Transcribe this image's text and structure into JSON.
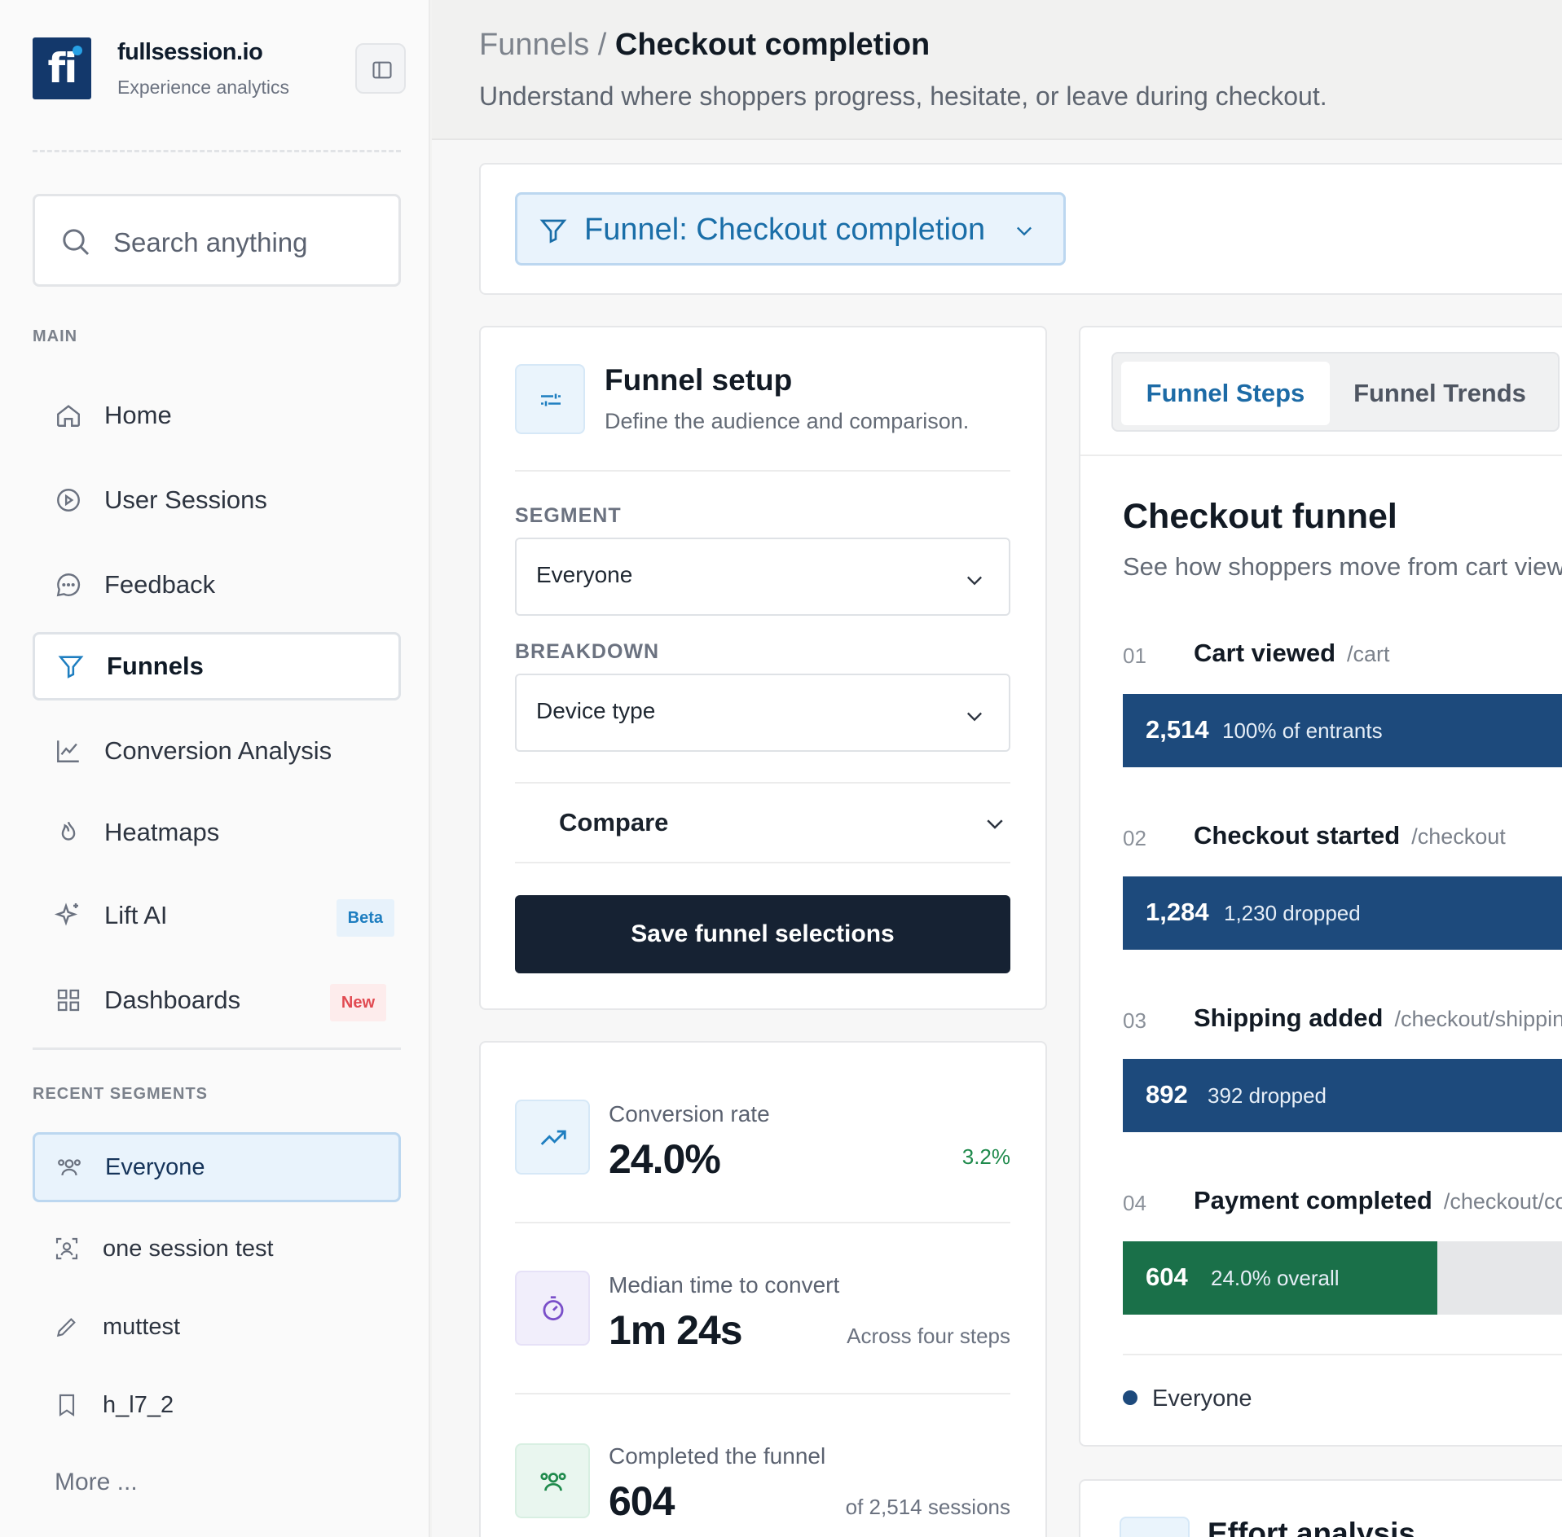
{
  "brand": {
    "logo_text": "fi",
    "name": "fullsession.io",
    "tagline": "Experience analytics"
  },
  "search": {
    "placeholder": "Search anything"
  },
  "sidebar": {
    "main_label": "MAIN",
    "items": [
      {
        "label": "Home",
        "icon": "home-icon"
      },
      {
        "label": "User Sessions",
        "icon": "play-circle-icon"
      },
      {
        "label": "Feedback",
        "icon": "chat-bubble-icon"
      },
      {
        "label": "Funnels",
        "icon": "funnel-icon",
        "active": true
      },
      {
        "label": "Conversion Analysis",
        "icon": "line-chart-icon"
      },
      {
        "label": "Heatmaps",
        "icon": "flame-icon"
      },
      {
        "label": "Lift AI",
        "icon": "sparkle-icon",
        "badge": "Beta"
      },
      {
        "label": "Dashboards",
        "icon": "grid-icon",
        "badge": "New"
      }
    ],
    "recent_label": "RECENT SEGMENTS",
    "segments": [
      {
        "label": "Everyone",
        "icon": "users-icon",
        "active": true
      },
      {
        "label": "one session test",
        "icon": "user-scan-icon"
      },
      {
        "label": "muttest",
        "icon": "pencil-icon"
      },
      {
        "label": "h_l7_2",
        "icon": "bookmark-icon"
      }
    ],
    "more": "More ..."
  },
  "header": {
    "breadcrumb_parent": "Funnels /",
    "breadcrumb_current": "Checkout completion",
    "subtitle": "Understand where shoppers progress, hesitate, or leave during checkout."
  },
  "funnel_selector": {
    "label": "Funnel: Checkout completion"
  },
  "setup": {
    "title": "Funnel setup",
    "subtitle": "Define the audience and comparison.",
    "segment_label": "SEGMENT",
    "segment_value": "Everyone",
    "breakdown_label": "BREAKDOWN",
    "breakdown_value": "Device type",
    "compare_label": "Compare",
    "save_label": "Save funnel selections"
  },
  "stats": [
    {
      "label": "Conversion rate",
      "value": "24.0%",
      "aside": "3.2%",
      "aside_color": "#1f8a4c",
      "icon": "trend-up-icon"
    },
    {
      "label": "Median time to convert",
      "value": "1m 24s",
      "aside": "Across four steps",
      "icon": "stopwatch-icon"
    },
    {
      "label": "Completed the funnel",
      "value": "604",
      "aside": "of 2,514 sessions",
      "icon": "users-icon"
    }
  ],
  "tabs": {
    "active": "Funnel Steps",
    "inactive": "Funnel Trends"
  },
  "checkout": {
    "title": "Checkout funnel",
    "subtitle": "See how shoppers move from cart view",
    "steps": [
      {
        "no": "01",
        "name": "Cart viewed",
        "path": "/cart",
        "count": "2,514",
        "note": "100% of entrants",
        "fraction": 1.0,
        "color": "#1d4a7c"
      },
      {
        "no": "02",
        "name": "Checkout started",
        "path": "/checkout",
        "count": "1,284",
        "note": "1,230 dropped",
        "fraction": 1.0,
        "color": "#1d4a7c"
      },
      {
        "no": "03",
        "name": "Shipping added",
        "path": "/checkout/shippin",
        "count": "892",
        "note": "392 dropped",
        "fraction": 1.0,
        "color": "#1d4a7c"
      },
      {
        "no": "04",
        "name": "Payment completed",
        "path": "/checkout/co",
        "count": "604",
        "note": "24.0% overall",
        "fraction": 0.717,
        "color": "#1a7049"
      }
    ],
    "legend": "Everyone"
  },
  "effort": {
    "title": "Effort analysis"
  }
}
